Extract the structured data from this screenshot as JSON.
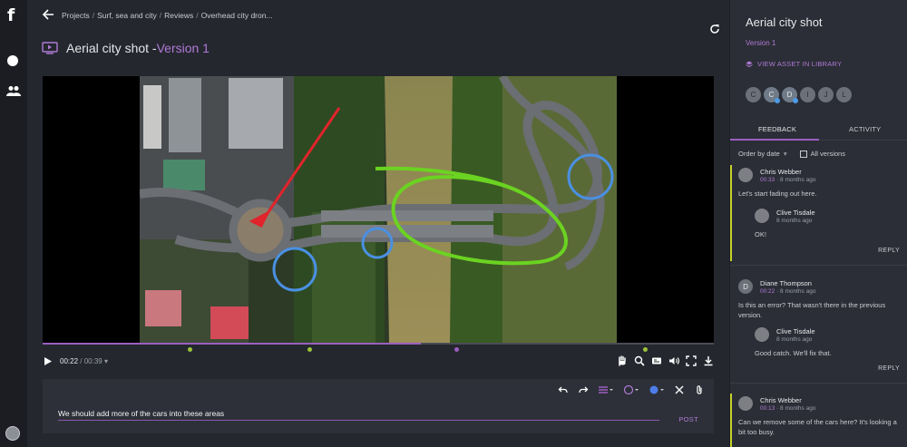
{
  "app": {
    "logo": "f"
  },
  "breadcrumb": [
    "Projects",
    "Surf, sea and city",
    "Reviews",
    "Overhead city dron..."
  ],
  "header": {
    "title": "Aerial city shot - ",
    "version": "Version 1"
  },
  "player": {
    "current_time": "00:22",
    "separator": " / ",
    "total_time": "00:39",
    "progress": 0.564
  },
  "timeline_markers": [
    {
      "position": 0.179,
      "color": "#9cc43a"
    },
    {
      "position": 0.358,
      "color": "#9cc43a"
    },
    {
      "position": 0.576,
      "color": "#9b5fc0"
    },
    {
      "position": 0.858,
      "color": "#9cc43a"
    }
  ],
  "editor": {
    "comment_text": "We should add more of the cars into these areas",
    "post_label": "POST"
  },
  "colors": {
    "accent": "#9b5fc0",
    "accent_text": "#b07ad6",
    "annotation_green": "#6bd321",
    "annotation_red": "#e0242b",
    "annotation_blue": "#4a90e2",
    "thread_bar": "#c4d22a"
  },
  "panel": {
    "title": "Aerial city shot",
    "version": "Version 1",
    "library_link": "VIEW ASSET IN LIBRARY",
    "avatars": [
      "C",
      "C",
      "D",
      "I",
      "J",
      "L"
    ],
    "tabs": [
      "FEEDBACK",
      "ACTIVITY"
    ],
    "sort_label": "Order by date",
    "all_versions_label": "All versions",
    "reply_label": "REPLY"
  },
  "threads": [
    {
      "author": "Chris Webber",
      "timecode": "00:33",
      "ago": " · 8 months ago",
      "text": "Let's start fading out here.",
      "reply": {
        "author": "Clive Tisdale",
        "ago": "8 months ago",
        "text": "OK!"
      }
    },
    {
      "author": "Diane Thompson",
      "initial": "D",
      "timecode": "00:22",
      "ago": " · 8 months ago",
      "text": "Is this an error? That wasn't there in the previous version.",
      "reply": {
        "author": "Clive Tisdale",
        "ago": "8 months ago",
        "text": "Good catch. We'll fix that."
      }
    },
    {
      "author": "Chris Webber",
      "timecode": "00:13",
      "ago": " · 8 months ago",
      "text": "Can we remove some of the cars here? It's looking a bit too busy."
    }
  ]
}
